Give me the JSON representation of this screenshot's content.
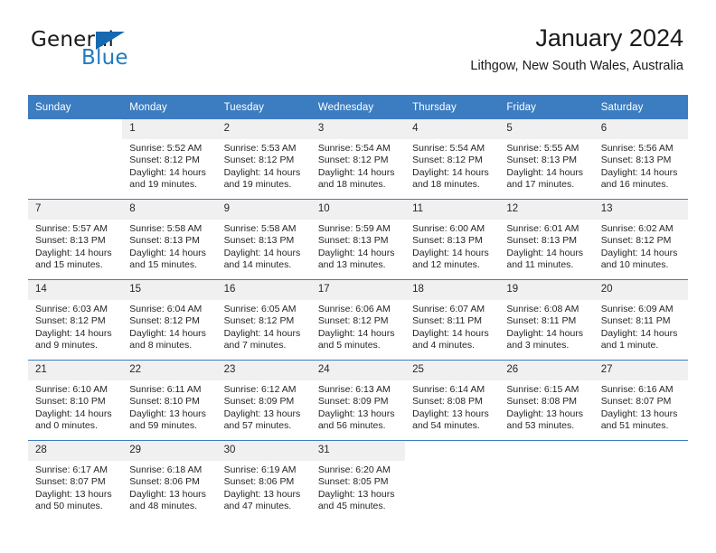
{
  "brand": {
    "word_one": "General",
    "word_two": "Blue",
    "logo_icon": "triangle-logo-icon"
  },
  "header": {
    "title": "January 2024",
    "subtitle": "Lithgow, New South Wales, Australia"
  },
  "calendar": {
    "weekday_headers": [
      "Sunday",
      "Monday",
      "Tuesday",
      "Wednesday",
      "Thursday",
      "Friday",
      "Saturday"
    ],
    "colors": {
      "header_bg": "#3b7dc0",
      "header_text": "#ffffff",
      "daynum_bg": "#f0f0f0",
      "row_divider": "#3b7dc0",
      "brand_blue": "#1f7ac0"
    },
    "weeks": [
      [
        {
          "day": "",
          "lines": [],
          "blank": true
        },
        {
          "day": "1",
          "lines": [
            "Sunrise: 5:52 AM",
            "Sunset: 8:12 PM",
            "Daylight: 14 hours",
            "and 19 minutes."
          ]
        },
        {
          "day": "2",
          "lines": [
            "Sunrise: 5:53 AM",
            "Sunset: 8:12 PM",
            "Daylight: 14 hours",
            "and 19 minutes."
          ]
        },
        {
          "day": "3",
          "lines": [
            "Sunrise: 5:54 AM",
            "Sunset: 8:12 PM",
            "Daylight: 14 hours",
            "and 18 minutes."
          ]
        },
        {
          "day": "4",
          "lines": [
            "Sunrise: 5:54 AM",
            "Sunset: 8:12 PM",
            "Daylight: 14 hours",
            "and 18 minutes."
          ]
        },
        {
          "day": "5",
          "lines": [
            "Sunrise: 5:55 AM",
            "Sunset: 8:13 PM",
            "Daylight: 14 hours",
            "and 17 minutes."
          ]
        },
        {
          "day": "6",
          "lines": [
            "Sunrise: 5:56 AM",
            "Sunset: 8:13 PM",
            "Daylight: 14 hours",
            "and 16 minutes."
          ]
        }
      ],
      [
        {
          "day": "7",
          "lines": [
            "Sunrise: 5:57 AM",
            "Sunset: 8:13 PM",
            "Daylight: 14 hours",
            "and 15 minutes."
          ]
        },
        {
          "day": "8",
          "lines": [
            "Sunrise: 5:58 AM",
            "Sunset: 8:13 PM",
            "Daylight: 14 hours",
            "and 15 minutes."
          ]
        },
        {
          "day": "9",
          "lines": [
            "Sunrise: 5:58 AM",
            "Sunset: 8:13 PM",
            "Daylight: 14 hours",
            "and 14 minutes."
          ]
        },
        {
          "day": "10",
          "lines": [
            "Sunrise: 5:59 AM",
            "Sunset: 8:13 PM",
            "Daylight: 14 hours",
            "and 13 minutes."
          ]
        },
        {
          "day": "11",
          "lines": [
            "Sunrise: 6:00 AM",
            "Sunset: 8:13 PM",
            "Daylight: 14 hours",
            "and 12 minutes."
          ]
        },
        {
          "day": "12",
          "lines": [
            "Sunrise: 6:01 AM",
            "Sunset: 8:13 PM",
            "Daylight: 14 hours",
            "and 11 minutes."
          ]
        },
        {
          "day": "13",
          "lines": [
            "Sunrise: 6:02 AM",
            "Sunset: 8:12 PM",
            "Daylight: 14 hours",
            "and 10 minutes."
          ]
        }
      ],
      [
        {
          "day": "14",
          "lines": [
            "Sunrise: 6:03 AM",
            "Sunset: 8:12 PM",
            "Daylight: 14 hours",
            "and 9 minutes."
          ]
        },
        {
          "day": "15",
          "lines": [
            "Sunrise: 6:04 AM",
            "Sunset: 8:12 PM",
            "Daylight: 14 hours",
            "and 8 minutes."
          ]
        },
        {
          "day": "16",
          "lines": [
            "Sunrise: 6:05 AM",
            "Sunset: 8:12 PM",
            "Daylight: 14 hours",
            "and 7 minutes."
          ]
        },
        {
          "day": "17",
          "lines": [
            "Sunrise: 6:06 AM",
            "Sunset: 8:12 PM",
            "Daylight: 14 hours",
            "and 5 minutes."
          ]
        },
        {
          "day": "18",
          "lines": [
            "Sunrise: 6:07 AM",
            "Sunset: 8:11 PM",
            "Daylight: 14 hours",
            "and 4 minutes."
          ]
        },
        {
          "day": "19",
          "lines": [
            "Sunrise: 6:08 AM",
            "Sunset: 8:11 PM",
            "Daylight: 14 hours",
            "and 3 minutes."
          ]
        },
        {
          "day": "20",
          "lines": [
            "Sunrise: 6:09 AM",
            "Sunset: 8:11 PM",
            "Daylight: 14 hours",
            "and 1 minute."
          ]
        }
      ],
      [
        {
          "day": "21",
          "lines": [
            "Sunrise: 6:10 AM",
            "Sunset: 8:10 PM",
            "Daylight: 14 hours",
            "and 0 minutes."
          ]
        },
        {
          "day": "22",
          "lines": [
            "Sunrise: 6:11 AM",
            "Sunset: 8:10 PM",
            "Daylight: 13 hours",
            "and 59 minutes."
          ]
        },
        {
          "day": "23",
          "lines": [
            "Sunrise: 6:12 AM",
            "Sunset: 8:09 PM",
            "Daylight: 13 hours",
            "and 57 minutes."
          ]
        },
        {
          "day": "24",
          "lines": [
            "Sunrise: 6:13 AM",
            "Sunset: 8:09 PM",
            "Daylight: 13 hours",
            "and 56 minutes."
          ]
        },
        {
          "day": "25",
          "lines": [
            "Sunrise: 6:14 AM",
            "Sunset: 8:08 PM",
            "Daylight: 13 hours",
            "and 54 minutes."
          ]
        },
        {
          "day": "26",
          "lines": [
            "Sunrise: 6:15 AM",
            "Sunset: 8:08 PM",
            "Daylight: 13 hours",
            "and 53 minutes."
          ]
        },
        {
          "day": "27",
          "lines": [
            "Sunrise: 6:16 AM",
            "Sunset: 8:07 PM",
            "Daylight: 13 hours",
            "and 51 minutes."
          ]
        }
      ],
      [
        {
          "day": "28",
          "lines": [
            "Sunrise: 6:17 AM",
            "Sunset: 8:07 PM",
            "Daylight: 13 hours",
            "and 50 minutes."
          ]
        },
        {
          "day": "29",
          "lines": [
            "Sunrise: 6:18 AM",
            "Sunset: 8:06 PM",
            "Daylight: 13 hours",
            "and 48 minutes."
          ]
        },
        {
          "day": "30",
          "lines": [
            "Sunrise: 6:19 AM",
            "Sunset: 8:06 PM",
            "Daylight: 13 hours",
            "and 47 minutes."
          ]
        },
        {
          "day": "31",
          "lines": [
            "Sunrise: 6:20 AM",
            "Sunset: 8:05 PM",
            "Daylight: 13 hours",
            "and 45 minutes."
          ]
        },
        {
          "day": "",
          "lines": [],
          "blank": true
        },
        {
          "day": "",
          "lines": [],
          "blank": true
        },
        {
          "day": "",
          "lines": [],
          "blank": true
        }
      ]
    ]
  }
}
